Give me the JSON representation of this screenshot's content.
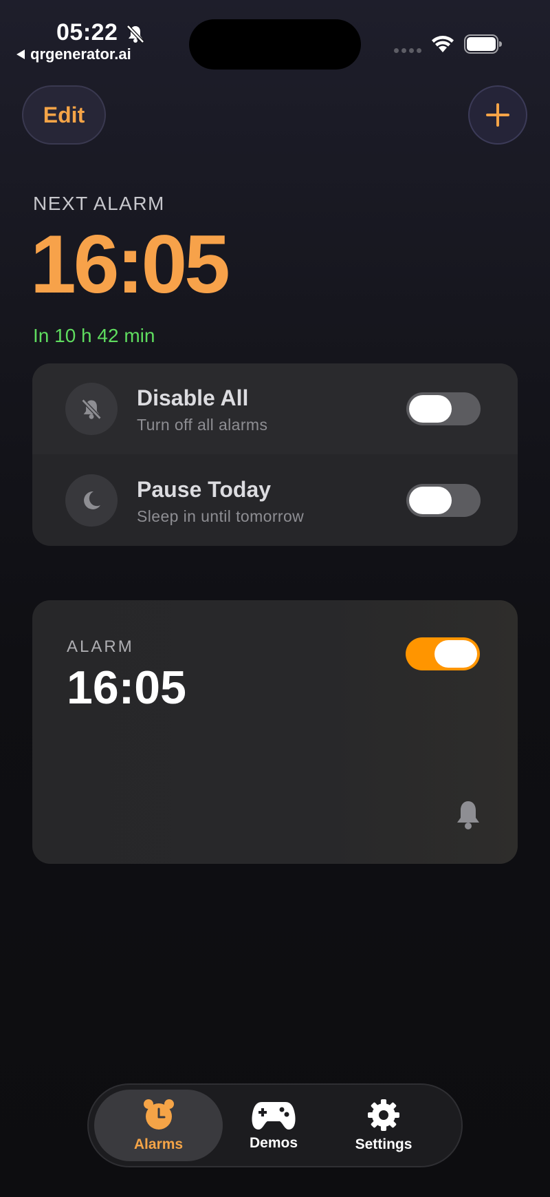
{
  "status_bar": {
    "time": "05:22",
    "back_app": "qrgenerator.ai"
  },
  "header": {
    "edit_label": "Edit",
    "add_icon": "plus-icon"
  },
  "next_alarm": {
    "label": "NEXT ALARM",
    "time": "16:05",
    "countdown": "In 10 h 42 min"
  },
  "options": [
    {
      "title": "Disable All",
      "subtitle": "Turn off all alarms",
      "icon": "bell-slash-icon",
      "enabled": false
    },
    {
      "title": "Pause Today",
      "subtitle": "Sleep in until tomorrow",
      "icon": "moon-icon",
      "enabled": false
    }
  ],
  "alarm": {
    "label": "ALARM",
    "time": "16:05",
    "enabled": true,
    "icon": "bell-icon"
  },
  "tabs": [
    {
      "label": "Alarms",
      "icon": "alarm-clock-icon",
      "active": true
    },
    {
      "label": "Demos",
      "icon": "gamepad-icon",
      "active": false
    },
    {
      "label": "Settings",
      "icon": "gear-icon",
      "active": false
    }
  ],
  "colors": {
    "accent": "#f7a24a",
    "toggle_on": "#ff9500",
    "countdown": "#5fdc5f"
  }
}
